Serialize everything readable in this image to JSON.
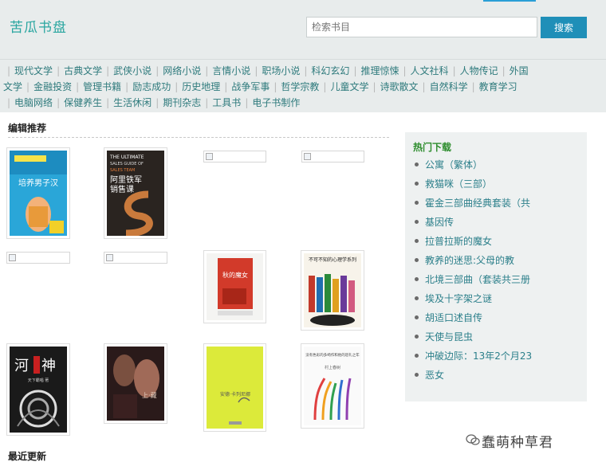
{
  "header": {
    "logo": "苦瓜书盘",
    "search_placeholder": "检索书目",
    "search_button": "搜索"
  },
  "categories": {
    "row1": [
      "现代文学",
      "古典文学",
      "武侠小说",
      "网络小说",
      "言情小说",
      "职场小说",
      "科幻玄幻",
      "推理惊悚",
      "人文社科",
      "人物传记",
      "外国"
    ],
    "row2": [
      "文学",
      "金融投资",
      "管理书籍",
      "励志成功",
      "历史地理",
      "战争军事",
      "哲学宗教",
      "儿童文学",
      "诗歌散文",
      "自然科学",
      "教育学习"
    ],
    "row3": [
      "电脑网络",
      "保健养生",
      "生活休闲",
      "期刊杂志",
      "工具书",
      "电子书制作"
    ]
  },
  "editor_picks": {
    "title": "编辑推荐",
    "book1": {
      "title": "培养男子汉"
    },
    "book2": {
      "title_en": "THE ULTIMATE SALES GUIDE OF ALIBABA SALES TEAM",
      "title_cn": "阿里铁军销售课"
    },
    "book5": {
      "title": "秋的魔女"
    },
    "book6": {
      "title": "不可不知的心理学系列"
    },
    "book7": {
      "title": "河神",
      "author": "天下霸唱 著"
    },
    "book9": {
      "title": "安德·卡列尼娜"
    },
    "book10": {
      "title": "没有色彩的多崎作和他的巡礼之年",
      "author": "村上春树"
    }
  },
  "recent": {
    "title": "最近更新"
  },
  "hot_downloads": {
    "title": "热门下载",
    "items": [
      "公寓（繁体）",
      "救猫咪（三部）",
      "霍金三部曲经典套装（共",
      "基因传",
      "拉普拉斯的魔女",
      "教养的迷思:父母的教",
      "北境三部曲（套装共三册",
      "埃及十字架之谜",
      "胡适口述自传",
      "天使与昆虫",
      "冲破边际：13年2个月23",
      "恶女"
    ]
  },
  "watermark": "蠢萌种草君",
  "colors": {
    "accent": "#1f8fb8",
    "logo": "#2aa6a0",
    "link": "#2b7f8a",
    "hot_title": "#2c8c2c"
  }
}
